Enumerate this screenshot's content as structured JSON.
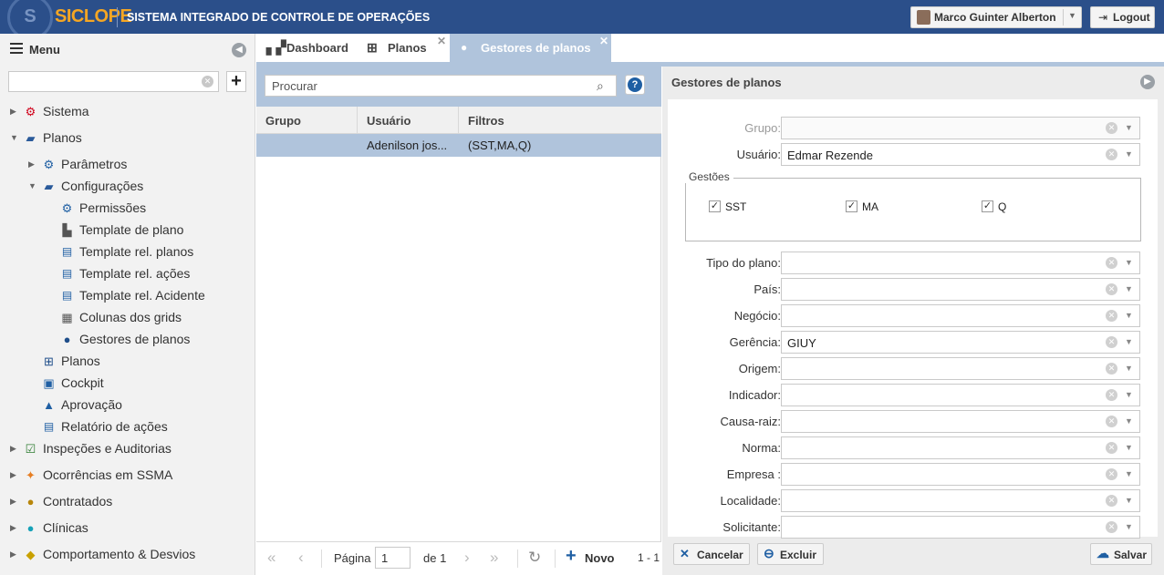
{
  "app": {
    "logo": "SICLOPE",
    "system_title": "SISTEMA INTEGRADO DE CONTROLE DE OPERAÇÕES"
  },
  "topbar": {
    "user_name": "Marco Guinter Alberton",
    "logout_label": "Logout"
  },
  "sidebar": {
    "title": "Menu",
    "search_value": "",
    "items": [
      {
        "label": "Sistema",
        "level": 0,
        "expanded": false,
        "icon": "gear-icon"
      },
      {
        "label": "Planos",
        "level": 0,
        "expanded": true,
        "icon": "folder-icon"
      },
      {
        "label": "Parâmetros",
        "level": 1,
        "expanded": false,
        "icon": "gear-icon"
      },
      {
        "label": "Configurações",
        "level": 1,
        "expanded": true,
        "icon": "folder-icon"
      },
      {
        "label": "Permissões",
        "level": 2,
        "icon": "gear-icon"
      },
      {
        "label": "Template de plano",
        "level": 2,
        "icon": "chart-icon"
      },
      {
        "label": "Template rel. planos",
        "level": 2,
        "icon": "pdf-icon"
      },
      {
        "label": "Template rel. ações",
        "level": 2,
        "icon": "pdf-icon"
      },
      {
        "label": "Template rel. Acidente",
        "level": 2,
        "icon": "pdf-icon"
      },
      {
        "label": "Colunas dos grids",
        "level": 2,
        "icon": "grid-icon"
      },
      {
        "label": "Gestores de planos",
        "level": 2,
        "icon": "user-icon"
      },
      {
        "label": "Planos",
        "level": 1,
        "icon": "map-icon"
      },
      {
        "label": "Cockpit",
        "level": 1,
        "icon": "dashboard-icon"
      },
      {
        "label": "Aprovação",
        "level": 1,
        "icon": "thumbs-up-icon"
      },
      {
        "label": "Relatório de ações",
        "level": 1,
        "icon": "pdf-icon"
      },
      {
        "label": "Inspeções e Auditorias",
        "level": 0,
        "expanded": false,
        "icon": "checklist-icon"
      },
      {
        "label": "Ocorrências em SSMA",
        "level": 0,
        "expanded": false,
        "icon": "accident-icon"
      },
      {
        "label": "Contratados",
        "level": 0,
        "expanded": false,
        "icon": "worker-icon"
      },
      {
        "label": "Clínicas",
        "level": 0,
        "expanded": false,
        "icon": "doctor-icon"
      },
      {
        "label": "Comportamento & Desvios",
        "level": 0,
        "expanded": false,
        "icon": "warning-icon"
      }
    ]
  },
  "tabs": [
    {
      "label": "Dashboard",
      "icon": "bar-chart-icon",
      "closable": false,
      "active": false
    },
    {
      "label": "Planos",
      "icon": "map-icon",
      "closable": true,
      "active": false
    },
    {
      "label": "Gestores de planos",
      "icon": "user-icon",
      "closable": true,
      "active": true
    }
  ],
  "grid": {
    "search_placeholder": "Procurar",
    "columns": [
      "Grupo",
      "Usuário",
      "Filtros"
    ],
    "rows": [
      {
        "grupo": "",
        "usuario": "Adenilson jos...",
        "filtros": "(SST,MA,Q)"
      }
    ],
    "footer": {
      "page_label": "Página",
      "page_value": "1",
      "of_label": "de 1",
      "new_label": "Novo",
      "range_label": "1 - 1"
    }
  },
  "detail": {
    "title": "Gestores de planos",
    "fields_top": [
      {
        "label": "Grupo:",
        "value": "",
        "disabled": true
      },
      {
        "label": "Usuário:",
        "value": "Edmar Rezende",
        "disabled": false
      }
    ],
    "gestoes": {
      "legend": "Gestões",
      "options": [
        {
          "label": "SST",
          "checked": true
        },
        {
          "label": "MA",
          "checked": true
        },
        {
          "label": "Q",
          "checked": true
        }
      ]
    },
    "fields": [
      {
        "label": "Tipo do plano:",
        "value": ""
      },
      {
        "label": "País:",
        "value": ""
      },
      {
        "label": "Negócio:",
        "value": ""
      },
      {
        "label": "Gerência:",
        "value": "GIUY"
      },
      {
        "label": "Origem:",
        "value": ""
      },
      {
        "label": "Indicador:",
        "value": ""
      },
      {
        "label": "Causa-raiz:",
        "value": ""
      },
      {
        "label": "Norma:",
        "value": ""
      },
      {
        "label": "Empresa :",
        "value": ""
      },
      {
        "label": "Localidade:",
        "value": ""
      },
      {
        "label": "Solicitante:",
        "value": ""
      }
    ],
    "buttons": {
      "cancel": "Cancelar",
      "delete": "Excluir",
      "save": "Salvar"
    }
  },
  "colors": {
    "topbar": "#2b4f8a",
    "logo": "#f5a623",
    "accent_panel": "#b0c4dc",
    "help": "#1f5fa3"
  }
}
